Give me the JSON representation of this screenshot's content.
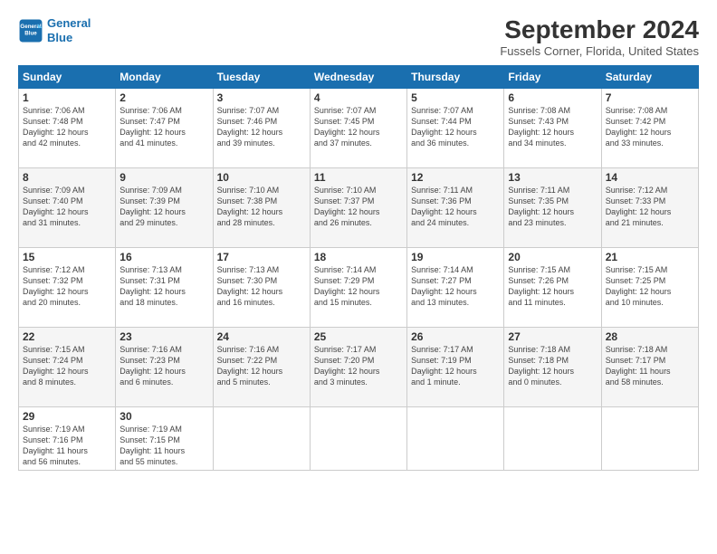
{
  "logo": {
    "line1": "General",
    "line2": "Blue"
  },
  "title": "September 2024",
  "location": "Fussels Corner, Florida, United States",
  "days_of_week": [
    "Sunday",
    "Monday",
    "Tuesday",
    "Wednesday",
    "Thursday",
    "Friday",
    "Saturday"
  ],
  "weeks": [
    [
      {
        "day": "1",
        "info": "Sunrise: 7:06 AM\nSunset: 7:48 PM\nDaylight: 12 hours\nand 42 minutes."
      },
      {
        "day": "2",
        "info": "Sunrise: 7:06 AM\nSunset: 7:47 PM\nDaylight: 12 hours\nand 41 minutes."
      },
      {
        "day": "3",
        "info": "Sunrise: 7:07 AM\nSunset: 7:46 PM\nDaylight: 12 hours\nand 39 minutes."
      },
      {
        "day": "4",
        "info": "Sunrise: 7:07 AM\nSunset: 7:45 PM\nDaylight: 12 hours\nand 37 minutes."
      },
      {
        "day": "5",
        "info": "Sunrise: 7:07 AM\nSunset: 7:44 PM\nDaylight: 12 hours\nand 36 minutes."
      },
      {
        "day": "6",
        "info": "Sunrise: 7:08 AM\nSunset: 7:43 PM\nDaylight: 12 hours\nand 34 minutes."
      },
      {
        "day": "7",
        "info": "Sunrise: 7:08 AM\nSunset: 7:42 PM\nDaylight: 12 hours\nand 33 minutes."
      }
    ],
    [
      {
        "day": "8",
        "info": "Sunrise: 7:09 AM\nSunset: 7:40 PM\nDaylight: 12 hours\nand 31 minutes."
      },
      {
        "day": "9",
        "info": "Sunrise: 7:09 AM\nSunset: 7:39 PM\nDaylight: 12 hours\nand 29 minutes."
      },
      {
        "day": "10",
        "info": "Sunrise: 7:10 AM\nSunset: 7:38 PM\nDaylight: 12 hours\nand 28 minutes."
      },
      {
        "day": "11",
        "info": "Sunrise: 7:10 AM\nSunset: 7:37 PM\nDaylight: 12 hours\nand 26 minutes."
      },
      {
        "day": "12",
        "info": "Sunrise: 7:11 AM\nSunset: 7:36 PM\nDaylight: 12 hours\nand 24 minutes."
      },
      {
        "day": "13",
        "info": "Sunrise: 7:11 AM\nSunset: 7:35 PM\nDaylight: 12 hours\nand 23 minutes."
      },
      {
        "day": "14",
        "info": "Sunrise: 7:12 AM\nSunset: 7:33 PM\nDaylight: 12 hours\nand 21 minutes."
      }
    ],
    [
      {
        "day": "15",
        "info": "Sunrise: 7:12 AM\nSunset: 7:32 PM\nDaylight: 12 hours\nand 20 minutes."
      },
      {
        "day": "16",
        "info": "Sunrise: 7:13 AM\nSunset: 7:31 PM\nDaylight: 12 hours\nand 18 minutes."
      },
      {
        "day": "17",
        "info": "Sunrise: 7:13 AM\nSunset: 7:30 PM\nDaylight: 12 hours\nand 16 minutes."
      },
      {
        "day": "18",
        "info": "Sunrise: 7:14 AM\nSunset: 7:29 PM\nDaylight: 12 hours\nand 15 minutes."
      },
      {
        "day": "19",
        "info": "Sunrise: 7:14 AM\nSunset: 7:27 PM\nDaylight: 12 hours\nand 13 minutes."
      },
      {
        "day": "20",
        "info": "Sunrise: 7:15 AM\nSunset: 7:26 PM\nDaylight: 12 hours\nand 11 minutes."
      },
      {
        "day": "21",
        "info": "Sunrise: 7:15 AM\nSunset: 7:25 PM\nDaylight: 12 hours\nand 10 minutes."
      }
    ],
    [
      {
        "day": "22",
        "info": "Sunrise: 7:15 AM\nSunset: 7:24 PM\nDaylight: 12 hours\nand 8 minutes."
      },
      {
        "day": "23",
        "info": "Sunrise: 7:16 AM\nSunset: 7:23 PM\nDaylight: 12 hours\nand 6 minutes."
      },
      {
        "day": "24",
        "info": "Sunrise: 7:16 AM\nSunset: 7:22 PM\nDaylight: 12 hours\nand 5 minutes."
      },
      {
        "day": "25",
        "info": "Sunrise: 7:17 AM\nSunset: 7:20 PM\nDaylight: 12 hours\nand 3 minutes."
      },
      {
        "day": "26",
        "info": "Sunrise: 7:17 AM\nSunset: 7:19 PM\nDaylight: 12 hours\nand 1 minute."
      },
      {
        "day": "27",
        "info": "Sunrise: 7:18 AM\nSunset: 7:18 PM\nDaylight: 12 hours\nand 0 minutes."
      },
      {
        "day": "28",
        "info": "Sunrise: 7:18 AM\nSunset: 7:17 PM\nDaylight: 11 hours\nand 58 minutes."
      }
    ],
    [
      {
        "day": "29",
        "info": "Sunrise: 7:19 AM\nSunset: 7:16 PM\nDaylight: 11 hours\nand 56 minutes."
      },
      {
        "day": "30",
        "info": "Sunrise: 7:19 AM\nSunset: 7:15 PM\nDaylight: 11 hours\nand 55 minutes."
      },
      null,
      null,
      null,
      null,
      null
    ]
  ]
}
